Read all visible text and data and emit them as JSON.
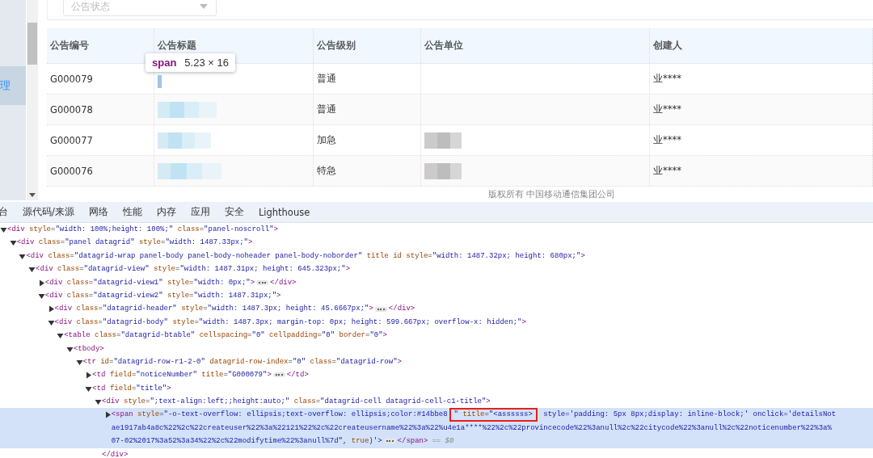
{
  "sidebar": {
    "items": [
      {
        "label": "理",
        "selected": true
      }
    ]
  },
  "filter": {
    "placeholder": "公告状态"
  },
  "table": {
    "columns": [
      "公告编号",
      "公告标题",
      "公告级别",
      "公告单位",
      "创建人"
    ],
    "rows": [
      {
        "number": "G000079",
        "title": {
          "kind": "inspected"
        },
        "level": "普通",
        "creator": "业****"
      },
      {
        "number": "G000078",
        "title": {
          "kind": "pixelated"
        },
        "level": "普通",
        "creator": "业****"
      },
      {
        "number": "G000077",
        "title": {
          "kind": "pixelated"
        },
        "level": "加急",
        "unit": {
          "kind": "pixelated"
        },
        "creator": "业****"
      },
      {
        "number": "G000076",
        "title": {
          "kind": "pixelated"
        },
        "level": "特急",
        "unit": {
          "kind": "pixelated"
        },
        "creator": "业****"
      }
    ]
  },
  "tooltip": {
    "tag": "span",
    "size": "5.23 × 16"
  },
  "footer": "版权所有 中国移动通信集团公司",
  "devtools": {
    "tabs": [
      {
        "label": "台",
        "selected": false
      },
      {
        "label": "源代码/来源",
        "selected": false
      },
      {
        "label": "网络",
        "selected": false
      },
      {
        "label": "性能",
        "selected": false
      },
      {
        "label": "内存",
        "selected": false
      },
      {
        "label": "应用",
        "selected": false
      },
      {
        "label": "安全",
        "selected": false
      },
      {
        "label": "Lighthouse",
        "selected": false
      }
    ],
    "tree": [
      {
        "text": "<div style=\"width: 100%;height: 100%;\" class=\"panel-noscroll\">",
        "expanded": true,
        "selected": false,
        "children": [
          {
            "text": "<div class=\"panel datagrid\" style=\"width: 1487.33px;\">",
            "expanded": true,
            "selected": false,
            "children": [
              {
                "text": "<div class=\"datagrid-wrap panel-body panel-body-noheader panel-body-noborder\" title id style=\"width: 1487.32px; height: 680px;\">",
                "expanded": true,
                "selected": false,
                "children": [
                  {
                    "text": "<div class=\"datagrid-view\" style=\"width: 1487.31px; height: 645.323px;\">",
                    "expanded": true,
                    "selected": false,
                    "children": [
                      {
                        "text": "<div class=\"datagrid-view1\" style=\"width: 0px;\">",
                        "expanded": false,
                        "selected": false,
                        "close": "</div>"
                      },
                      {
                        "text": "<div class=\"datagrid-view2\" style=\"width: 1487.31px;\">",
                        "expanded": true,
                        "selected": false,
                        "children": [
                          {
                            "text": "<div class=\"datagrid-header\" style=\"width: 1487.3px; height: 45.6667px;\">",
                            "expanded": false,
                            "selected": false,
                            "close": "</div>"
                          },
                          {
                            "text": "<div class=\"datagrid-body\" style=\"width: 1487.3px; margin-top: 0px; height: 599.667px; overflow-x: hidden;\">",
                            "expanded": true,
                            "selected": false,
                            "children": [
                              {
                                "text": "<table class=\"datagrid-btable\" cellspacing=\"0\" cellpadding=\"0\" border=\"0\">",
                                "expanded": true,
                                "selected": false,
                                "children": [
                                  {
                                    "text": "<tbody>",
                                    "expanded": true,
                                    "selected": false,
                                    "children": [
                                      {
                                        "text": "<tr id=\"datagrid-row-r1-2-0\" datagrid-row-index=\"0\" class=\"datagrid-row\">",
                                        "expanded": true,
                                        "selected": false,
                                        "children": [
                                          {
                                            "text": "<td field=\"noticeNumber\" title=\"G000079\">",
                                            "expanded": false,
                                            "selected": false,
                                            "close": "</td>"
                                          },
                                          {
                                            "text": "<td field=\"title\">",
                                            "expanded": true,
                                            "selected": false,
                                            "children": [
                                              {
                                                "text": "<div style=\";text-align:left;;height:auto;\" class=\"datagrid-cell datagrid-cell-c1-title\">",
                                                "expanded": true,
                                                "selected": false,
                                                "end_tag": "</div>",
                                                "children": [
                                                  {
                                                    "lines": [
                                                      [
                                                        {
                                                          "text": "<span style=\"-o-text-overflow: ellipsis;text-overflow: ellipsis;color:#14bbe8",
                                                          "boxed": false
                                                        },
                                                        {
                                                          "text": "\" title=\"<assssss>",
                                                          "boxed": true
                                                        },
                                                        {
                                                          "text": " style='padding: 5px 8px;display: inline-block;' onclick='detailsNot",
                                                          "boxed": false
                                                        }
                                                      ],
                                                      [
                                                        {
                                                          "text": "ae1917ab4a8c%22%2c%22createuser%22%3a%22121%22%2c%22createusername%22%3a%22%u4e1a****%22%2c%22provincecode%22%3anull%2c%22citycode%22%3anull%2c%22noticenumber%22%3a%",
                                                          "boxed": false
                                                        }
                                                      ],
                                                      [
                                                        {
                                                          "text": "07-02%2017%3a52%3a34%22%2c%22modifytime%22%3anull%7d\", true)'>",
                                                          "boxed": false
                                                        }
                                                      ]
                                                    ],
                                                    "expanded": false,
                                                    "selected": true,
                                                    "close": "</span>",
                                                    "console_ref": "== $0"
                                                  }
                                                ]
                                              }
                                            ]
                                          }
                                        ]
                                      }
                                    ]
                                  }
                                ]
                              }
                            ]
                          }
                        ]
                      }
                    ]
                  }
                ]
              }
            ]
          }
        ]
      }
    ]
  }
}
